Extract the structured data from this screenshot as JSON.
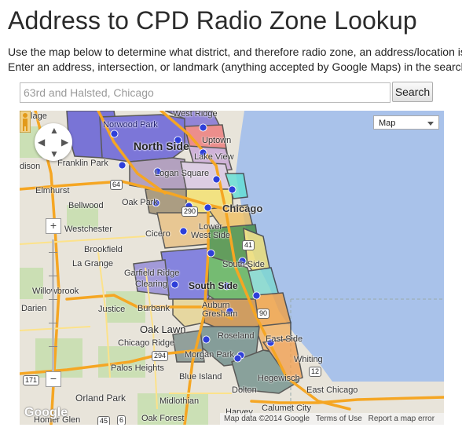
{
  "page": {
    "title": "Address to CPD Radio Zone Lookup",
    "intro_line1": "Use the map below to determine what district, and therefore radio zone, an address/location is",
    "intro_line2": "Enter an address, intersection, or landmark (anything accepted by Google Maps) in the search"
  },
  "search": {
    "placeholder": "63rd and Halsted, Chicago",
    "value": "",
    "button_label": "Search"
  },
  "map": {
    "type_selector": "Map",
    "zoom_in": "+",
    "zoom_out": "−",
    "attribution": "Map data ©2014 Google",
    "terms": "Terms of Use",
    "report": "Report a map error",
    "logo": "Google",
    "place_labels": {
      "village": "Village",
      "west_ridge": "West Ridge",
      "norwood_park": "Norwood Park",
      "uptown": "Uptown",
      "north_side": "North Side",
      "franklin_park": "Franklin Park",
      "lake_view": "Lake View",
      "edison": "dison",
      "logan_square": "Logan Square",
      "elmhurst": "Elmhurst",
      "bellwood": "Bellwood",
      "oak_park": "Oak Park",
      "chicago": "Chicago",
      "westchester": "Westchester",
      "cicero": "Cicero",
      "lower_west_side": "Lower West Side",
      "brookfield": "Brookfield",
      "la_grange": "La Grange",
      "south_side_1": "South Side",
      "garfield_ridge": "Garfield Ridge",
      "clearing": "Clearing",
      "south_side_2": "South Side",
      "willowbrook": "Willowbrook",
      "justice": "Justice",
      "burbank": "Burbank",
      "auburn_gresham": "Auburn Gresham",
      "darien": "Darien",
      "oak_lawn": "Oak Lawn",
      "chicago_ridge": "Chicago Ridge",
      "roseland": "Roseland",
      "east_side": "East Side",
      "morgan_park": "Morgan Park",
      "palos_heights": "Palos Heights",
      "whiting": "Whiting",
      "blue_island": "Blue Island",
      "hegewisch": "Hegewisch",
      "dolton": "Dolton",
      "east_chicago": "East Chicago",
      "orland_park": "Orland Park",
      "midlothian": "Midlothian",
      "harvey": "Harvey",
      "calumet_city": "Calumet City",
      "homer_glen": "Homer Glen",
      "oak_forest": "Oak Forest"
    },
    "highways": [
      "64",
      "290",
      "41",
      "90",
      "294",
      "171",
      "12",
      "45",
      "6"
    ]
  }
}
